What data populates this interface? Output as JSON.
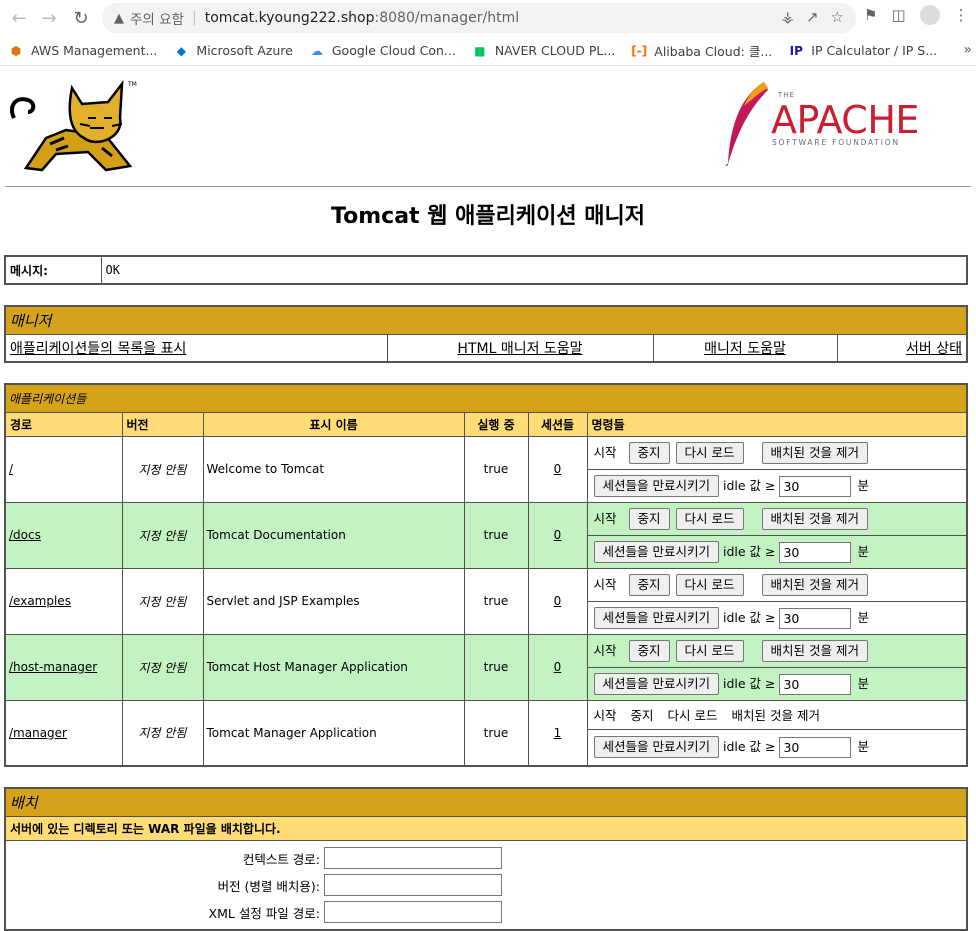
{
  "browser": {
    "security_label": "주의 요함",
    "url_host": "tomcat.kyoung222.shop",
    "url_path": ":8080/manager/html",
    "bookmarks": [
      {
        "label": "AWS Management...",
        "icon": "aws-icon",
        "color": "#ec7211"
      },
      {
        "label": "Microsoft Azure",
        "icon": "azure-icon",
        "color": "#0078d4"
      },
      {
        "label": "Google Cloud Con...",
        "icon": "google-cloud-icon",
        "color": "#4285f4"
      },
      {
        "label": "NAVER CLOUD PL...",
        "icon": "naver-cloud-icon",
        "color": "#03c75a"
      },
      {
        "label": "Alibaba Cloud: 클...",
        "icon": "alibaba-icon",
        "color": "#ff6a00"
      },
      {
        "label": "IP Calculator / IP S...",
        "icon": "ip-calculator-icon",
        "color": "#1a1aa6"
      }
    ],
    "more_label": "»"
  },
  "page": {
    "title": "Tomcat 웹 애플리케이션 매니저",
    "message_label": "메시지:",
    "message_value": "OK",
    "apache_the": "THE",
    "apache_word": "APACHE",
    "apache_sub": "SOFTWARE FOUNDATION"
  },
  "manager": {
    "heading": "매니저",
    "links": [
      "애플리케이션들의 목록을 표시",
      "HTML 매니저 도움말",
      "매니저 도움말",
      "서버 상태"
    ]
  },
  "applications": {
    "heading": "애플리케이션들",
    "columns": [
      "경로",
      "버전",
      "표시 이름",
      "실행 중",
      "세션들",
      "명령들"
    ],
    "rows": [
      {
        "path": "/",
        "version": "지정 안됨",
        "display": "Welcome to Tomcat",
        "running": "true",
        "sessions": "0",
        "idle": "30"
      },
      {
        "path": "/docs",
        "version": "지정 안됨",
        "display": "Tomcat Documentation",
        "running": "true",
        "sessions": "0",
        "idle": "30"
      },
      {
        "path": "/examples",
        "version": "지정 안됨",
        "display": "Servlet and JSP Examples",
        "running": "true",
        "sessions": "0",
        "idle": "30"
      },
      {
        "path": "/host-manager",
        "version": "지정 안됨",
        "display": "Tomcat Host Manager Application",
        "running": "true",
        "sessions": "0",
        "idle": "30"
      },
      {
        "path": "/manager",
        "version": "지정 안됨",
        "display": "Tomcat Manager Application",
        "running": "true",
        "sessions": "1",
        "idle": "30"
      }
    ],
    "commands": {
      "start": "시작",
      "stop": "중지",
      "reload": "다시 로드",
      "undeploy": "배치된 것을 제거",
      "expire": "세션들을 만료시키기",
      "idle_prefix": "idle 값 ≥",
      "minutes": "분"
    }
  },
  "deploy": {
    "heading": "배치",
    "subheading": "서버에 있는 디렉토리 또는 WAR 파일을 배치합니다.",
    "fields": [
      "컨텍스트 경로:",
      "버전 (병렬 배치용):",
      "XML 설정 파일 경로:"
    ]
  }
}
